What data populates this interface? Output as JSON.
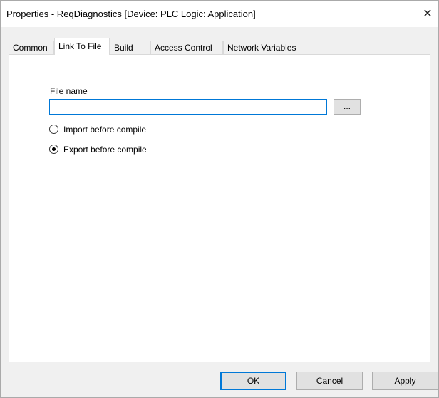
{
  "window": {
    "title": "Properties - ReqDiagnostics [Device: PLC Logic: Application]",
    "close_glyph": "✕"
  },
  "tabs": [
    {
      "label": "Common",
      "active": false
    },
    {
      "label": "Link To File",
      "active": true
    },
    {
      "label": "Build",
      "active": false
    },
    {
      "label": "Access Control",
      "active": false
    },
    {
      "label": "Network Variables",
      "active": false
    }
  ],
  "link_to_file": {
    "file_name_label": "File name",
    "file_name_value": "",
    "browse_label": "...",
    "options": [
      {
        "label": "Import before compile",
        "selected": false
      },
      {
        "label": "Export before compile",
        "selected": true
      }
    ]
  },
  "buttons": {
    "ok": "OK",
    "cancel": "Cancel",
    "apply": "Apply"
  },
  "icons": {
    "close": "close-icon"
  },
  "colors": {
    "accent": "#0078d7",
    "dialog_bg": "#f0f0f0",
    "panel_bg": "#ffffff"
  }
}
